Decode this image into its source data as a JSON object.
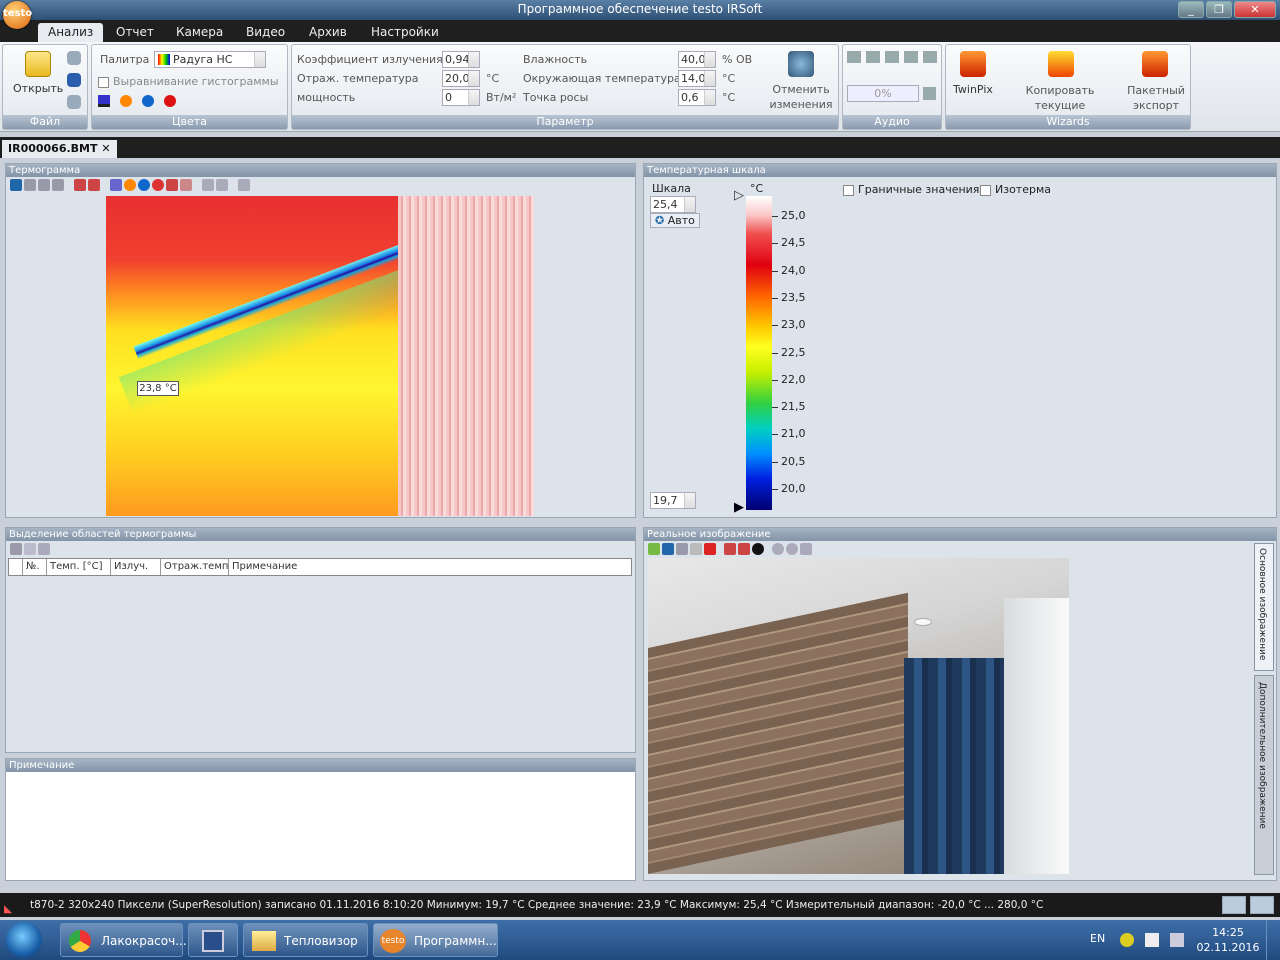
{
  "window": {
    "title": "Программное обеспечение testo IRSoft",
    "logo_text": "testo"
  },
  "menu_tabs": [
    "Анализ",
    "Отчет",
    "Камера",
    "Видео",
    "Архив",
    "Настройки"
  ],
  "ribbon": {
    "file": {
      "open_label": "Открыть",
      "group_label": "Файл"
    },
    "colors": {
      "palette_label": "Палитра",
      "palette_value": "Радуга HC",
      "histogram_label": "Выравнивание гистограммы",
      "group_label": "Цвета"
    },
    "params": {
      "emissivity_label": "Коэффициент излучения",
      "emissivity_value": "0,94",
      "refl_temp_label": "Отраж. температура",
      "refl_temp_value": "20,0",
      "refl_temp_unit": "°C",
      "power_label": "мощность",
      "power_value": "0",
      "power_unit": "Вт/м²",
      "humidity_label": "Влажность",
      "humidity_value": "40,0",
      "humidity_unit": "% ОВ",
      "ambient_label": "Окружающая температура",
      "ambient_value": "14,0",
      "ambient_unit": "°C",
      "dew_label": "Точка росы",
      "dew_value": "0,6",
      "dew_unit": "°C",
      "undo_label": "Отменить изменения",
      "group_label": "Параметр"
    },
    "audio": {
      "progress": "0%",
      "group_label": "Аудио"
    },
    "wizards": {
      "twinpix": "TwinPix",
      "copy": "Копировать текущие настройки",
      "batch": "Пакетный экспорт",
      "group_label": "Wizards"
    }
  },
  "document_tab": "IR000066.BMT",
  "thermogram": {
    "title": "Термограмма",
    "measure_label": "23,8 °C"
  },
  "temp_scale": {
    "title": "Температурная шкала",
    "scale_label": "Шкала",
    "unit": "°C",
    "max_value": "25,4",
    "min_value": "19,7",
    "auto_label": "Авто",
    "limits_label": "Граничные значения",
    "isotherm_label": "Изотерма",
    "ticks": [
      "25,0",
      "24,5",
      "24,0",
      "23,5",
      "23,0",
      "22,5",
      "22,0",
      "21,5",
      "21,0",
      "20,5",
      "20,0"
    ]
  },
  "regions": {
    "title": "Выделение областей термограммы",
    "columns": [
      "№.",
      "Темп. [°C]",
      "Излуч.",
      "Отраж.темп",
      "Примечание"
    ]
  },
  "note": {
    "title": "Примечание"
  },
  "real_image": {
    "title": "Реальное изображение",
    "side_tab_main": "Основное изображение",
    "side_tab_extra": "Дополнительное изображение"
  },
  "status": {
    "text": "t870-2  320x240  Пиксели  (SuperResolution)  записано  01.11.2016  8:10:20  Минимум:  19,7 °C  Среднее значение:  23,9 °C  Максимум:  25,4 °C  Измерительный диапазон:  -20,0 °C ... 280,0 °C"
  },
  "taskbar": {
    "items": [
      "Лакокрасоч...",
      "Тепловизор",
      "Программн..."
    ],
    "lang": "EN",
    "time": "14:25",
    "date": "02.11.2016"
  }
}
